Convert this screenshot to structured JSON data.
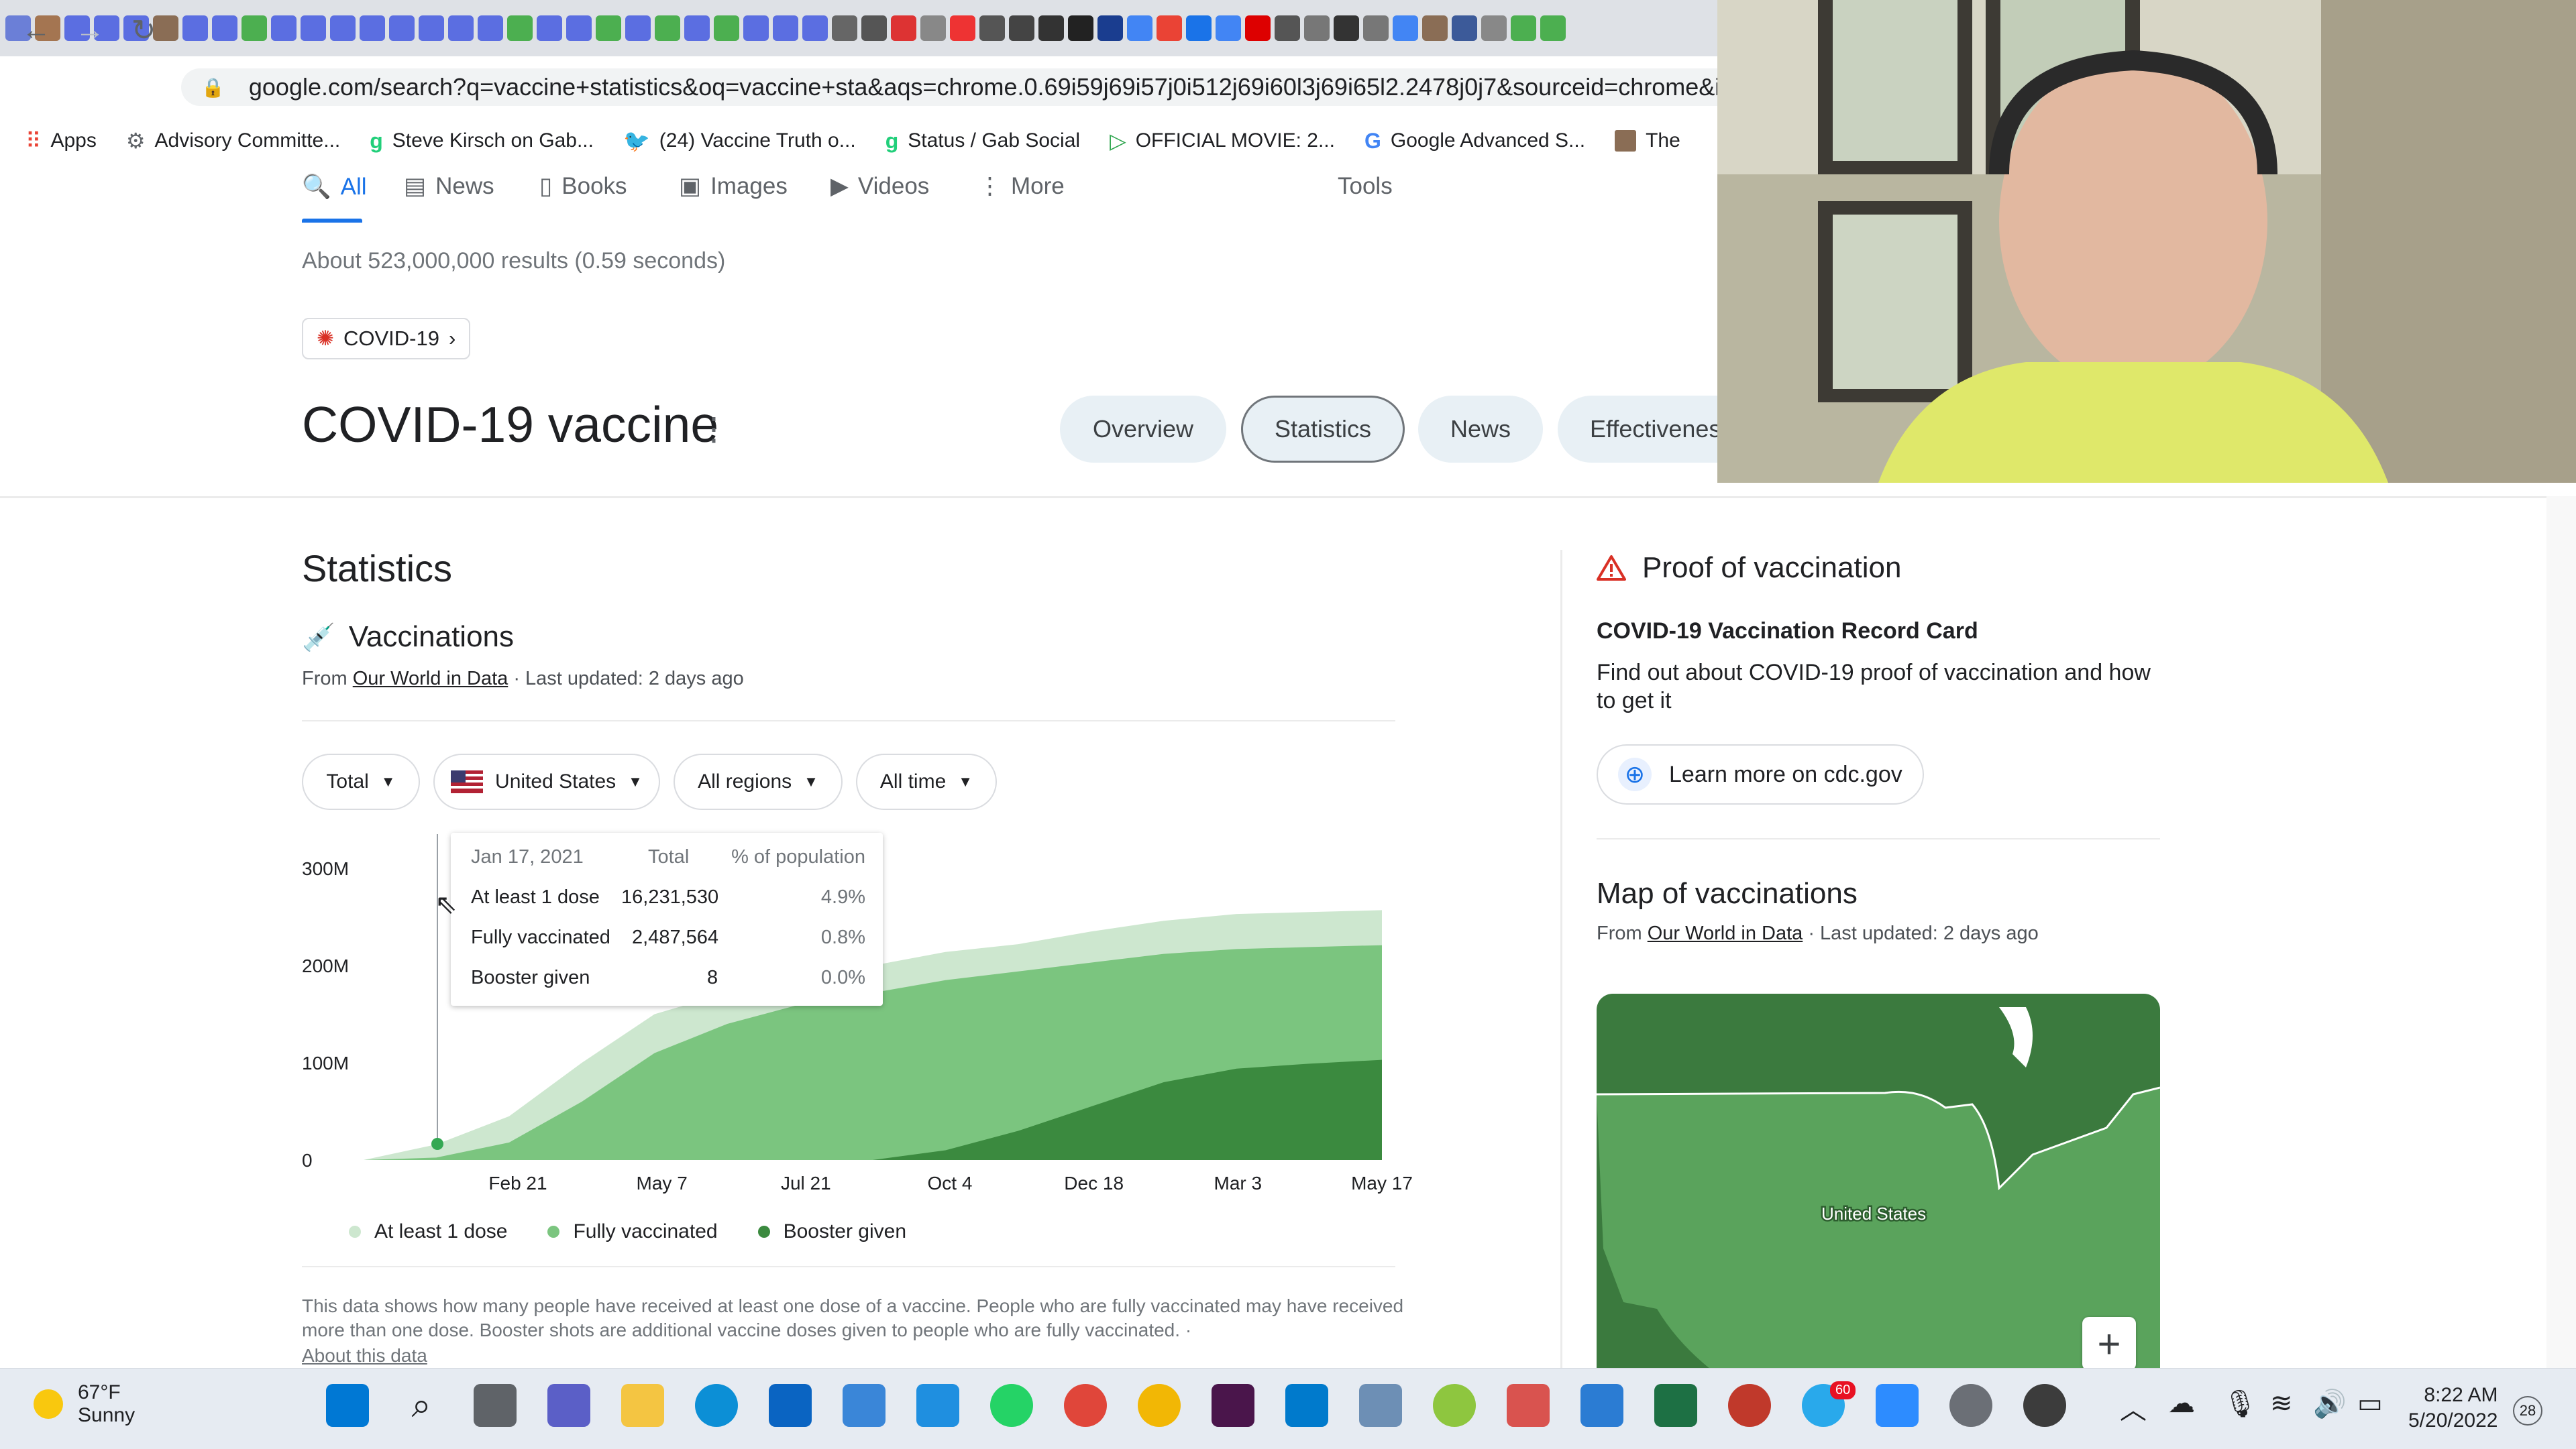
{
  "browser": {
    "url": "google.com/search?q=vaccine+statistics&oq=vaccine+sta&aqs=chrome.0.69i59j69i57j0i512j69i60l3j69i65l2.2478j0j7&sourceid=chrome&ie=U",
    "bookmarks": [
      {
        "label": "Apps",
        "icon": "apps-grid-icon"
      },
      {
        "label": "Advisory Committe...",
        "icon": "bike-icon"
      },
      {
        "label": "Steve Kirsch on Gab...",
        "icon": "gab-icon"
      },
      {
        "label": "(24) Vaccine Truth o...",
        "icon": "twitter-icon"
      },
      {
        "label": "Status / Gab Social",
        "icon": "gab-icon"
      },
      {
        "label": "OFFICIAL MOVIE: 2...",
        "icon": "play-icon"
      },
      {
        "label": "Google Advanced S...",
        "icon": "google-icon"
      },
      {
        "label": "The",
        "icon": "avatar-icon"
      }
    ]
  },
  "search": {
    "tabs": [
      "All",
      "News",
      "Books",
      "Images",
      "Videos",
      "More"
    ],
    "tools": "Tools",
    "results_count": "About 523,000,000 results (0.59 seconds)",
    "chip": "COVID-19"
  },
  "knowledge_panel": {
    "title": "COVID-19 vaccine",
    "pills": [
      "Overview",
      "Statistics",
      "News",
      "Effectivenes"
    ]
  },
  "statistics": {
    "heading": "Statistics",
    "subheading": "Vaccinations",
    "source_prefix": "From ",
    "source_link": "Our World in Data",
    "source_suffix": " · Last updated: 2 days ago",
    "filters": [
      "Total",
      "United States",
      "All regions",
      "All time"
    ],
    "tooltip": {
      "date": "Jan 17, 2021",
      "col_total": "Total",
      "col_pct": "% of population",
      "rows": [
        {
          "label": "At least 1 dose",
          "total": "16,231,530",
          "pct": "4.9%"
        },
        {
          "label": "Fully vaccinated",
          "total": "2,487,564",
          "pct": "0.8%"
        },
        {
          "label": "Booster given",
          "total": "8",
          "pct": "0.0%"
        }
      ]
    },
    "note": "This data shows how many people have received at least one dose of a vaccine. People who are fully vaccinated may have received more than one dose. Booster shots are additional vaccine doses given to people who are fully vaccinated.",
    "note_sep": "·",
    "about_link": "About this data"
  },
  "chart_data": {
    "type": "area",
    "x_labels": [
      "Feb 21",
      "May 7",
      "Jul 21",
      "Oct 4",
      "Dec 18",
      "Mar 3",
      "May 17"
    ],
    "y_ticks": [
      "0",
      "100M",
      "200M",
      "300M"
    ],
    "ylim": [
      0,
      300
    ],
    "y_unit": "M",
    "x": [
      "Dec 13",
      "Jan 17",
      "Feb 21",
      "Mar 28",
      "May 7",
      "Jun 11",
      "Jul 21",
      "Aug 25",
      "Oct 4",
      "Nov 8",
      "Dec 18",
      "Jan 22",
      "Mar 3",
      "Apr 7",
      "May 17"
    ],
    "series": [
      {
        "name": "At least 1 dose",
        "color": "#cde7cf",
        "values": [
          0,
          16,
          45,
          100,
          150,
          172,
          186,
          200,
          214,
          222,
          235,
          246,
          253,
          255,
          257
        ]
      },
      {
        "name": "Fully vaccinated",
        "color": "#7bc57f",
        "values": [
          0,
          2.5,
          18,
          60,
          110,
          140,
          160,
          172,
          185,
          194,
          203,
          212,
          217,
          219,
          221
        ]
      },
      {
        "name": "Booster given",
        "color": "#3b8a3f",
        "values": [
          0,
          0,
          0,
          0,
          0,
          0,
          0,
          0,
          10,
          30,
          55,
          80,
          94,
          99,
          103
        ]
      }
    ],
    "legend_position": "bottom",
    "grid": false
  },
  "proof": {
    "heading": "Proof of vaccination",
    "record_title": "COVID-19 Vaccination Record Card",
    "description": "Find out about COVID-19 proof of vaccination and how to get it",
    "button": "Learn more on cdc.gov"
  },
  "map": {
    "heading": "Map of vaccinations",
    "source_prefix": "From ",
    "source_link": "Our World in Data",
    "source_suffix": " · Last updated: 2 days ago",
    "label": "United States",
    "zoom": "+"
  },
  "taskbar": {
    "temp": "67°F",
    "condition": "Sunny",
    "time": "8:22 AM",
    "date": "5/20/2022",
    "notifications": "28",
    "telegram_badge": "60"
  },
  "colors": {
    "accent": "#1a73e8",
    "dose1": "#cde7cf",
    "full": "#7bc57f",
    "booster": "#3b8a3f"
  }
}
